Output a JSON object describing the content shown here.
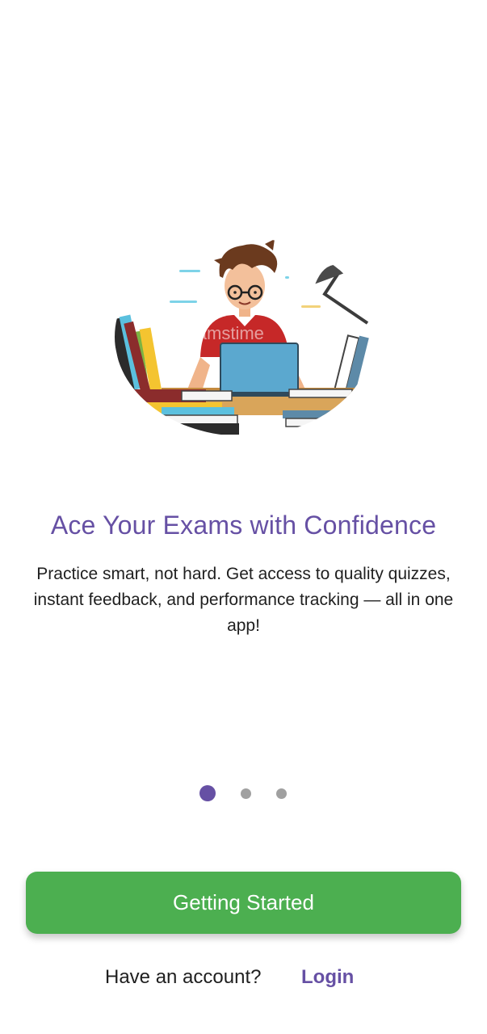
{
  "onboarding": {
    "title": "Ace Your Exams with Confidence",
    "description": "Practice smart, not hard. Get access to quality quizzes, instant feedback, and performance tracking — all in one app!",
    "illustration_watermark": "dreamstime",
    "page_indicator": {
      "total_pages": 3,
      "current_page": 1
    }
  },
  "actions": {
    "primary_label": "Getting Started",
    "account_prompt": "Have an account?",
    "login_label": "Login"
  },
  "colors": {
    "accent": "#6650a4",
    "button": "#4caf50",
    "inactive_dot": "#a0a0a0",
    "text": "#1f1f1f"
  }
}
